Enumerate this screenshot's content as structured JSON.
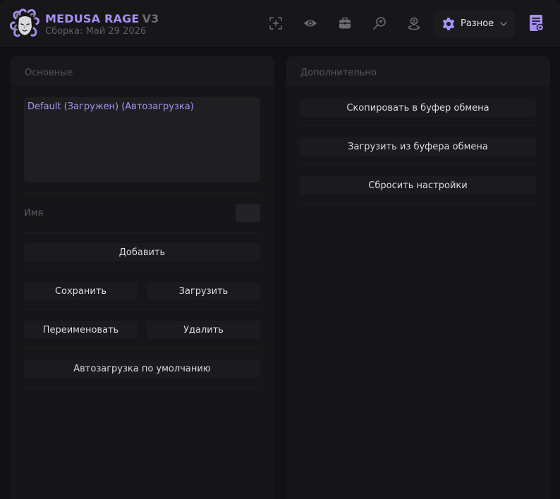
{
  "header": {
    "brand_name": "MEDUSA RAGE",
    "brand_version": "V3",
    "build_label": "Сборка: Май 29 2026",
    "nav_icons": [
      "crosshair-icon",
      "eye-icon",
      "briefcase-icon",
      "search-radar-icon",
      "location-person-icon"
    ],
    "dropdown": {
      "label": "Разное",
      "icon": "gear-icon"
    },
    "config_icon": "config-list-icon"
  },
  "left_panel": {
    "title": "Основные",
    "configs": [
      "Default (Загружен) (Автозагрузка)"
    ],
    "name_label": "Имя",
    "name_value": "",
    "buttons": {
      "add": "Добавить",
      "save": "Сохранить",
      "load": "Загрузить",
      "rename": "Переименовать",
      "delete": "Удалить",
      "autoload": "Автозагрузка по умолчанию"
    }
  },
  "right_panel": {
    "title": "Дополнительно",
    "buttons": {
      "copy": "Скопировать в буфер обмена",
      "paste": "Загрузить из буфера обмена",
      "reset": "Сбросить настройки"
    }
  },
  "colors": {
    "accent": "#a88ef5",
    "background": "#111113",
    "panel": "#161618",
    "button": "#1b1b1e"
  }
}
